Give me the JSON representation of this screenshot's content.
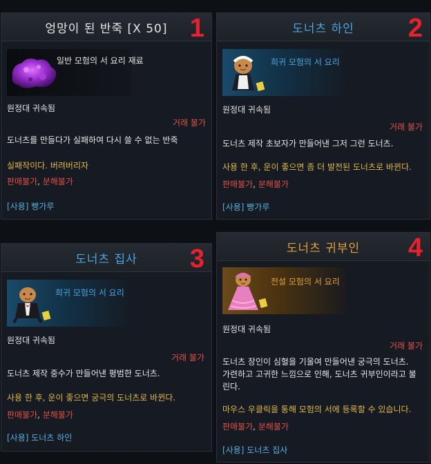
{
  "panels": [
    {
      "number": "1",
      "title": "엉망이 된 반죽 [X 50]",
      "grade": "일반 모험의 서 요리 재료",
      "bound": "원정대 귀속됨",
      "trade": "거래 불가",
      "description": "도너츠를 만들다가 실패하여 다시 쓸 수 없는 반죽",
      "effect": "실패작이다. 버려버리자",
      "sell_a": "판매불가",
      "sell_sep": ", ",
      "sell_b": "분해불가",
      "usage": "[사용] 빵가루",
      "icon": "purple-dough-icon"
    },
    {
      "number": "2",
      "title": "도너츠 하인",
      "grade": "희귀 모험의 서 요리",
      "bound": "원정대 귀속됨",
      "trade": "거래 불가",
      "description": "도너츠 제작 초보자가 만들어낸 그저 그런 도너츠.",
      "effect": "사용 한 후, 운이 좋으면 좀 더 발전된 도너츠로 바뀐다.",
      "sell_a": "판매불가",
      "sell_sep": ", ",
      "sell_b": "분해불가",
      "usage": "[사용] 빵가루",
      "icon": "maid-cookie-icon"
    },
    {
      "number": "3",
      "title": "도너츠 집사",
      "grade": "희귀 모험의 서 요리",
      "bound": "원정대 귀속됨",
      "trade": "거래 불가",
      "description": "도너츠 제작 중수가 만들어낸 평범한 도너츠.",
      "effect": "사용 한 후, 운이 좋으면 궁극의 도너츠로 바뀐다.",
      "sell_a": "판매불가",
      "sell_sep": ", ",
      "sell_b": "분해불가",
      "usage": "[사용] 도너츠 하인",
      "icon": "butler-cookie-icon"
    },
    {
      "number": "4",
      "title": "도너츠 귀부인",
      "grade": "전설 모험의 서 요리",
      "bound": "원정대 귀속됨",
      "trade": "거래 불가",
      "description_1": "도너츠 장인이 심혈을 기울여 만들어낸 궁극의 도너츠.",
      "description_2": "가련하고 고귀한 느낌으로 인해, 도너츠 귀부인이라고 불",
      "description_3": "린다.",
      "effect": "마우스 우클릭을 통해 모험의 서에 등록할 수 있습니다.",
      "sell_a": "판매불가",
      "sell_sep": ", ",
      "sell_b": "분해불가",
      "usage": "[사용] 도너츠 집사",
      "icon": "lady-cookie-icon"
    }
  ],
  "colors": {
    "common_title": "#e8e8e8",
    "rare_title": "#4aa6de",
    "legend_title": "#e2a03a",
    "warning_red": "#e05048",
    "effect_yellow": "#e2b84a",
    "usage_blue": "#5ab0e0",
    "number_red": "#e8222c"
  }
}
